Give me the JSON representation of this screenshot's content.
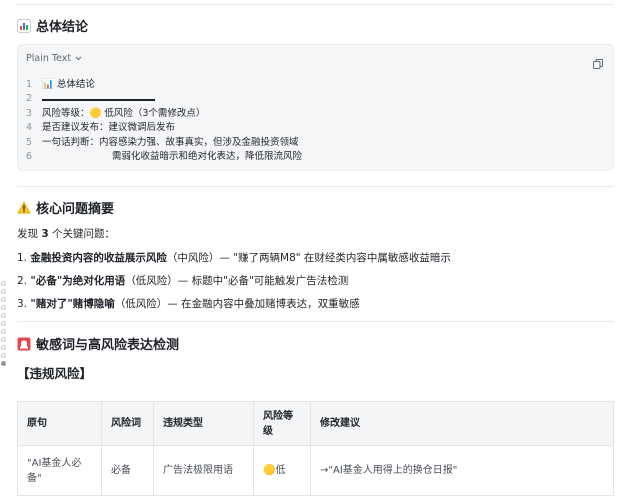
{
  "sections": {
    "summary": {
      "title": "总体结论",
      "icon": "bar-chart-icon"
    },
    "issues": {
      "title": "核心问题摘要",
      "icon": "warning-icon",
      "intro_prefix": "发现 ",
      "intro_count": "3",
      "intro_suffix": " 个关键问题：",
      "items": [
        {
          "num": "1. ",
          "bold": "金融投资内容的收益展示风险",
          "rest": "（中风险）— \"赚了两辆M8\" 在财经类内容中属敏感收益暗示"
        },
        {
          "num": "2. ",
          "bold": "\"必备\"为绝对化用语",
          "rest": "（低风险）— 标题中\"必备\"可能触发广告法检测"
        },
        {
          "num": "3. ",
          "bold": "\"赌对了\"赌博隐喻",
          "rest": "（低风险）— 在金融内容中叠加赌博表达，双重敏感"
        }
      ]
    },
    "sensitive": {
      "title": "敏感词与高风险表达检测",
      "icon": "siren-icon",
      "subheading": "【违规风险】"
    }
  },
  "codeblock": {
    "language": "Plain Text",
    "lines": [
      {
        "n": "1",
        "text": "📊 总体结论"
      },
      {
        "n": "2",
        "text": ""
      },
      {
        "n": "3",
        "text": "风险等级：🟡 低风险（3个需修改点）"
      },
      {
        "n": "4",
        "text": "是否建议发布：建议微调后发布"
      },
      {
        "n": "5",
        "text": "一句话判断：内容感染力强、故事真实，但涉及金融投资领域"
      },
      {
        "n": "6",
        "text": "需弱化收益暗示和绝对化表达，降低限流风险"
      }
    ]
  },
  "table": {
    "headers": [
      "原句",
      "风险词",
      "违规类型",
      "风险等级",
      "修改建议"
    ],
    "rows": [
      [
        "\"AI基金人必备\"",
        "必备",
        "广告法极限用语",
        "🟡低",
        "→\"AI基金人用得上的换仓日报\""
      ]
    ]
  },
  "colors": {
    "text": "#1f2329",
    "muted": "#646a73",
    "code_bg": "#f5f6f7",
    "border": "#e3e4e6"
  }
}
